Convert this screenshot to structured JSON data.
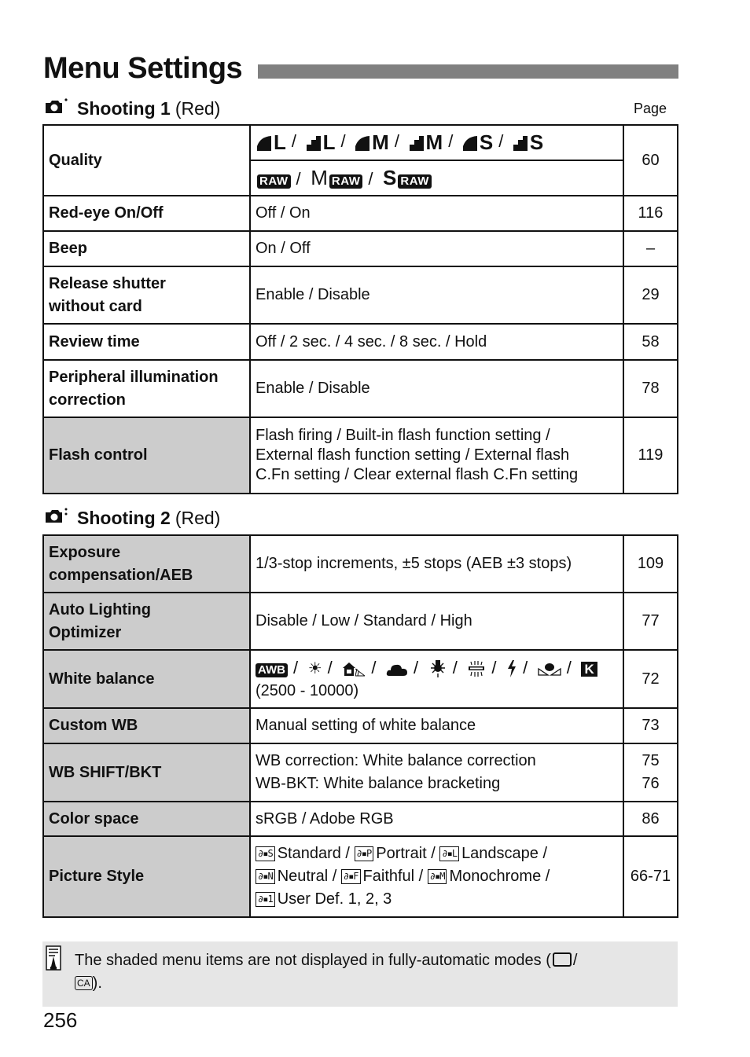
{
  "page_title": "Menu Settings",
  "page_column_label": "Page",
  "sections": [
    {
      "icon": "camera-shooting-1-icon",
      "name": "Shooting 1",
      "color": "(Red)",
      "rows": [
        {
          "setting": "Quality",
          "shaded": false,
          "options_line1": [
            {
              "icon": "fine-quality-icon",
              "size": "L"
            },
            {
              "icon": "normal-quality-icon",
              "size": "L"
            },
            {
              "icon": "fine-quality-icon",
              "size": "M"
            },
            {
              "icon": "normal-quality-icon",
              "size": "M"
            },
            {
              "icon": "fine-quality-icon",
              "size": "S"
            },
            {
              "icon": "normal-quality-icon",
              "size": "S"
            }
          ],
          "options_line2": [
            {
              "prefix": "",
              "badge": "RAW"
            },
            {
              "prefix": "M",
              "badge": "RAW"
            },
            {
              "prefix": "S",
              "badge": "RAW"
            }
          ],
          "page": "60"
        },
        {
          "setting": "Red-eye On/Off",
          "shaded": false,
          "options": "Off / On",
          "page": "116"
        },
        {
          "setting": "Beep",
          "shaded": false,
          "options": "On / Off",
          "page": "–"
        },
        {
          "setting_line1": "Release shutter",
          "setting_line2": "without card",
          "shaded": false,
          "options": "Enable / Disable",
          "page": "29"
        },
        {
          "setting": "Review time",
          "shaded": false,
          "options": "Off / 2 sec. / 4 sec. / 8 sec. / Hold",
          "page": "58"
        },
        {
          "setting_line1": "Peripheral illumination",
          "setting_line2": "correction",
          "shaded": false,
          "options": "Enable / Disable",
          "page": "78"
        },
        {
          "setting": "Flash control",
          "shaded": true,
          "options_line1": "Flash firing / Built-in flash function setting /",
          "options_line2": "External flash function setting / External flash",
          "options_line3": "C.Fn setting / Clear external flash C.Fn setting",
          "page": "119"
        }
      ]
    },
    {
      "icon": "camera-shooting-2-icon",
      "name": "Shooting 2",
      "color": "(Red)",
      "rows": [
        {
          "setting_line1": "Exposure",
          "setting_line2": "compensation/AEB",
          "shaded": true,
          "options": "1/3-stop increments, ±5 stops (AEB ±3 stops)",
          "page": "109"
        },
        {
          "setting_line1": "Auto Lighting",
          "setting_line2": "Optimizer",
          "shaded": true,
          "options": "Disable / Low / Standard / High",
          "page": "77"
        },
        {
          "setting": "White balance",
          "shaded": true,
          "wb_icons": [
            "AWB",
            "daylight",
            "shade",
            "cloudy",
            "tungsten",
            "fluorescent",
            "flash",
            "custom",
            "K"
          ],
          "awb_label": "AWB",
          "k_label": "K",
          "options_line2": "(2500 - 10000)",
          "page": "72"
        },
        {
          "setting": "Custom WB",
          "shaded": true,
          "options": "Manual setting of white balance",
          "page": "73"
        },
        {
          "setting": "WB SHIFT/BKT",
          "shaded": true,
          "options_line1": "WB correction: White balance correction",
          "options_line2": "WB-BKT: White balance bracketing",
          "page_line1": "75",
          "page_line2": "76"
        },
        {
          "setting": "Color space",
          "shaded": true,
          "options": "sRGB / Adobe RGB",
          "page": "86"
        },
        {
          "setting": "Picture Style",
          "shaded": true,
          "styles": [
            {
              "code": "S",
              "label": "Standard /"
            },
            {
              "code": "P",
              "label": "Portrait /"
            },
            {
              "code": "L",
              "label": "Landscape /"
            },
            {
              "code": "N",
              "label": "Neutral /"
            },
            {
              "code": "F",
              "label": "Faithful /"
            },
            {
              "code": "M",
              "label": "Monochrome /"
            },
            {
              "code": "1",
              "label": "User Def. 1, 2, 3"
            }
          ],
          "page": "66-71"
        }
      ]
    }
  ],
  "note": {
    "icon": "memo-pencil-icon",
    "text_before": "The shaded menu items are not displayed in fully-automatic modes (",
    "mode1_icon": "full-auto-mode-icon",
    "slash": "/",
    "mode2_label": "CA",
    "text_after": ")."
  },
  "page_number": "256",
  "colors": {
    "title_bar": "#808080",
    "shaded_cell": "#cccccc",
    "note_bg": "#e6e6e6"
  }
}
